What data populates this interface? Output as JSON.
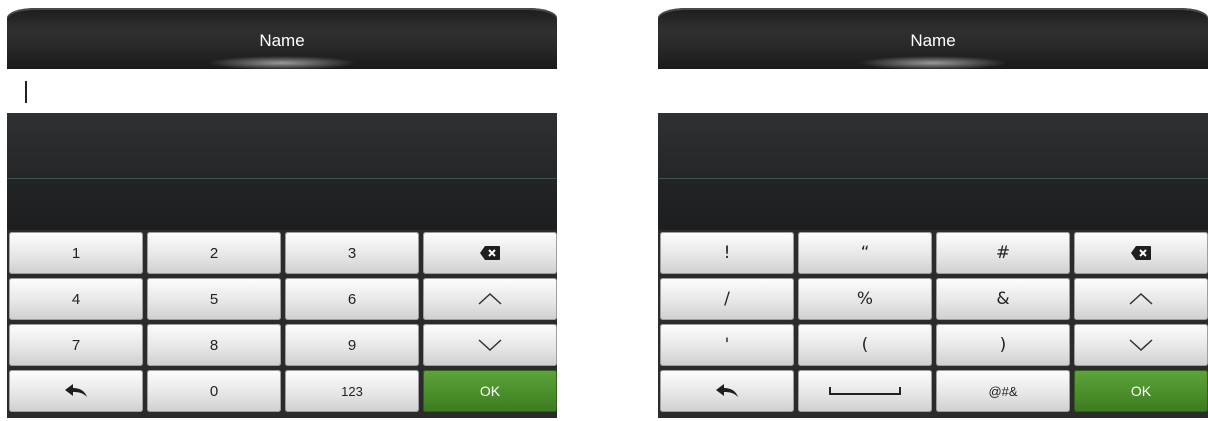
{
  "left_panel": {
    "title": "Name",
    "keys": {
      "r0": [
        "1",
        "2",
        "3"
      ],
      "r1": [
        "4",
        "5",
        "6"
      ],
      "r2": [
        "7",
        "8",
        "9"
      ],
      "r3_mid": [
        "0",
        "123"
      ],
      "ok": "OK"
    },
    "icons": {
      "backspace": "backspace-icon",
      "up": "chevron-up-icon",
      "down": "chevron-down-icon",
      "back": "back-arrow-icon"
    }
  },
  "right_panel": {
    "title": "Name",
    "keys": {
      "r0": [
        "!",
        "“",
        "#"
      ],
      "r1": [
        "/",
        "%",
        "&"
      ],
      "r2": [
        "'",
        "(",
        ")"
      ],
      "r3_mid": [
        "@#&"
      ],
      "ok": "OK"
    },
    "icons": {
      "backspace": "backspace-icon",
      "up": "chevron-up-icon",
      "down": "chevron-down-icon",
      "back": "back-arrow-icon",
      "space": "space-bar-icon"
    }
  },
  "colors": {
    "header": "#1c1c1c",
    "ok_key": "#4b8f2b",
    "key": "#e7e7e7"
  }
}
